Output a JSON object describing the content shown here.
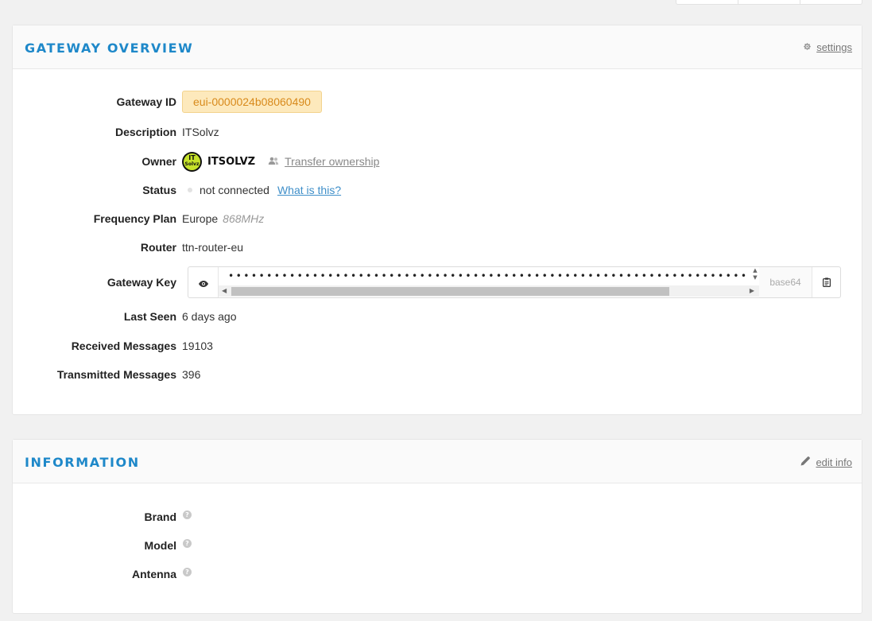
{
  "overview": {
    "title": "GATEWAY OVERVIEW",
    "settings_label": "settings",
    "fields": {
      "gateway_id": {
        "label": "Gateway ID",
        "value": "eui-0000024b08060490"
      },
      "description": {
        "label": "Description",
        "value": "ITSolvz"
      },
      "owner": {
        "label": "Owner",
        "name": "ITSOLVZ",
        "avatar_text_1": "IT",
        "avatar_text_2": "Solvz",
        "transfer_label": "Transfer ownership"
      },
      "status": {
        "label": "Status",
        "value": "not connected",
        "help_link": "What is this?"
      },
      "frequency_plan": {
        "label": "Frequency Plan",
        "region": "Europe",
        "band": "868MHz"
      },
      "router": {
        "label": "Router",
        "value": "ttn-router-eu"
      },
      "gateway_key": {
        "label": "Gateway Key",
        "masked": "••••••••••••••••••••••••••••••••••••••••••••••••••••••••••••••••••••••••••••••••••••••••••••••••••••••••",
        "encoding": "base64"
      },
      "last_seen": {
        "label": "Last Seen",
        "value": "6 days ago"
      },
      "received": {
        "label": "Received Messages",
        "value": "19103"
      },
      "transmitted": {
        "label": "Transmitted Messages",
        "value": "396"
      }
    }
  },
  "information": {
    "title": "INFORMATION",
    "edit_label": "edit info",
    "fields": {
      "brand": {
        "label": "Brand"
      },
      "model": {
        "label": "Model"
      },
      "antenna": {
        "label": "Antenna"
      }
    },
    "help_glyph": "?"
  },
  "colors": {
    "accent": "#1e88c9",
    "link": "#3f8fc9",
    "badge_bg": "#fde9bc",
    "badge_text": "#d88a1c",
    "status_idle": "#e2e2e2"
  }
}
